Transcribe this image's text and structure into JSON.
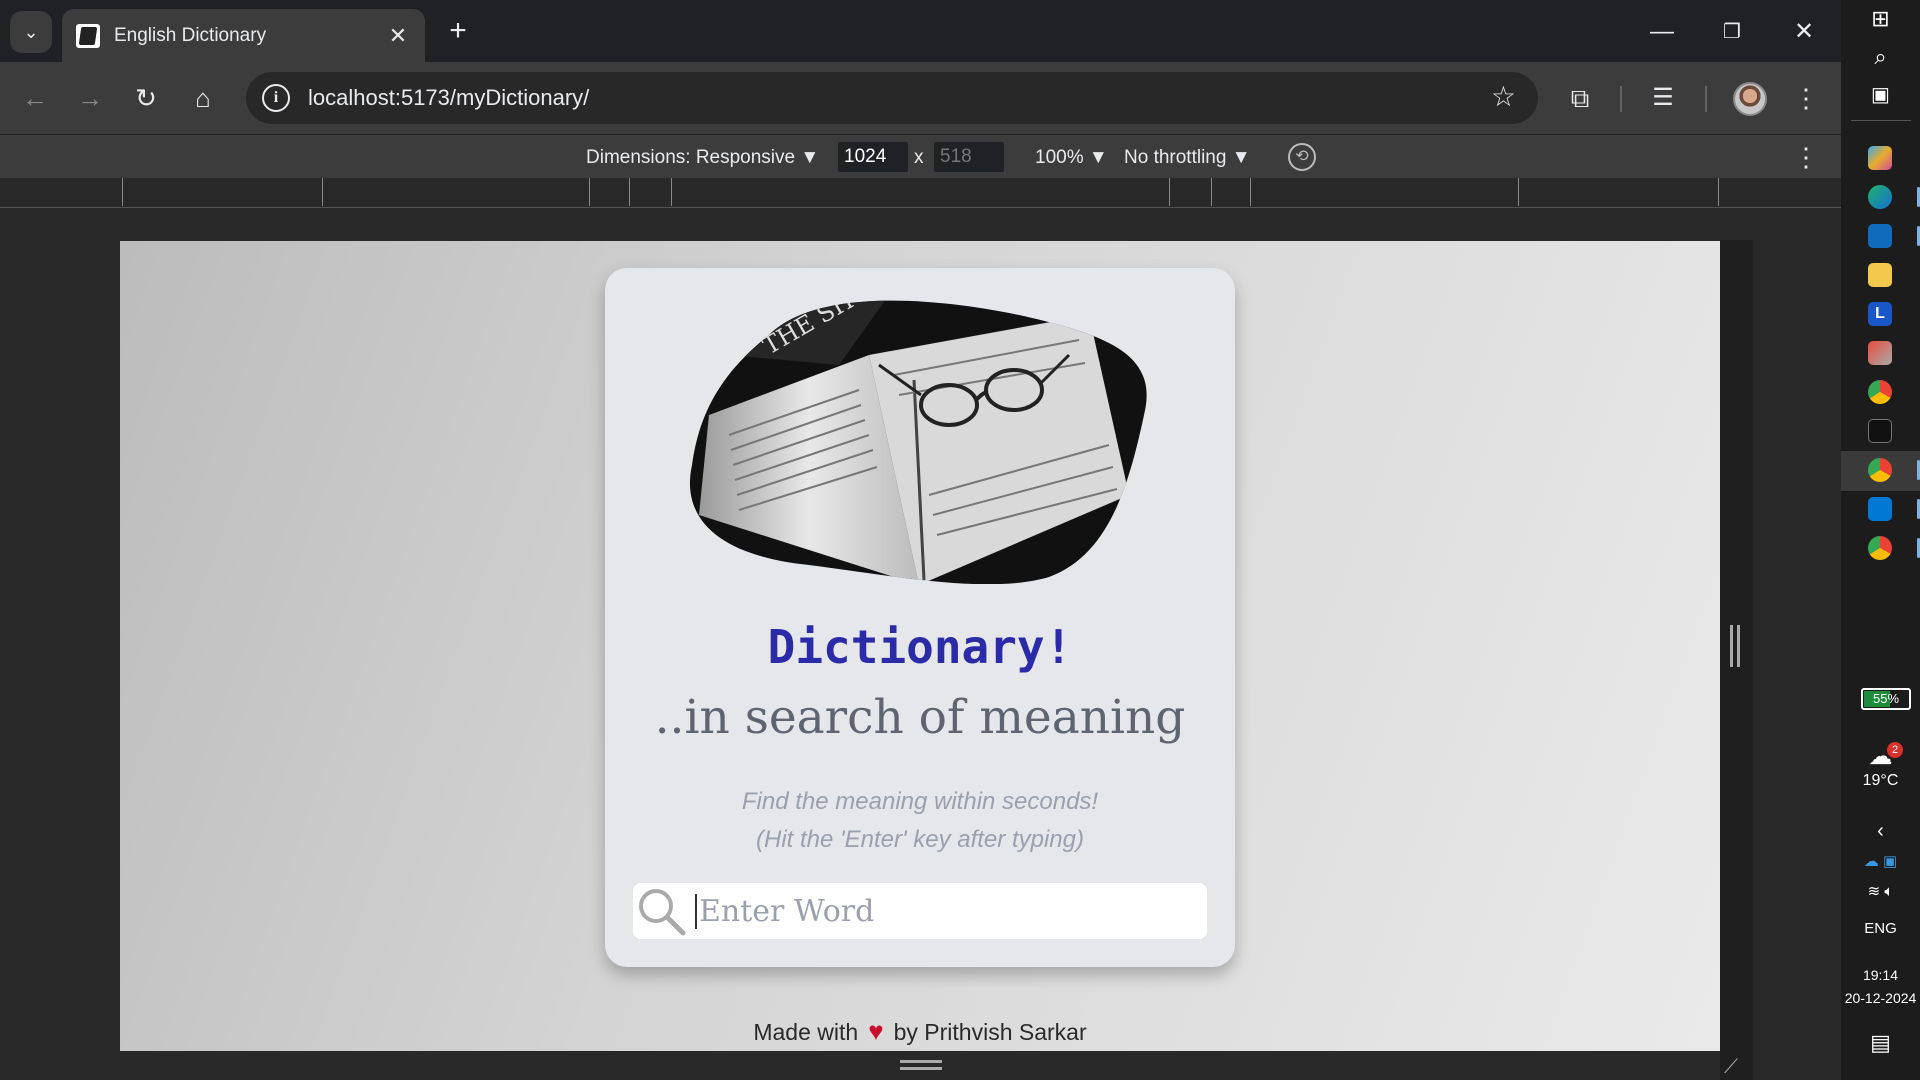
{
  "browser": {
    "tab_title": "English Dictionary",
    "url_host": "localhost",
    "url_rest": ":5173/myDictionary/",
    "new_tab": "+",
    "close_tab": "✕"
  },
  "devtools": {
    "dimensions_label": "Dimensions: Responsive ▼",
    "width": "1024",
    "times": "x",
    "height": "518",
    "zoom": "100% ▼",
    "throttling": "No throttling ▼"
  },
  "app": {
    "title": "Dictionary!",
    "tagline": "..in search of meaning",
    "hint_line1": "Find the meaning within seconds!",
    "hint_line2": "(Hit the 'Enter' key after typing)",
    "search_placeholder": "Enter Word",
    "footer_prefix": "Made with",
    "footer_suffix": "by Prithvish Sarkar"
  },
  "taskbar": {
    "battery": "55%",
    "weather_badge": "2",
    "temperature": "19°C",
    "language": "ENG",
    "time": "19:14",
    "date": "20-12-2024"
  },
  "colors": {
    "title": "#2b2ba8",
    "card": "#e5e7eb",
    "heart": "#c8102e"
  }
}
